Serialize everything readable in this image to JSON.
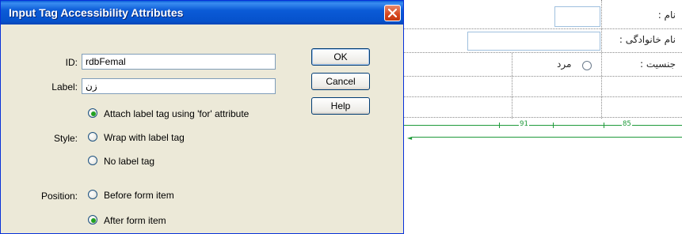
{
  "dialog": {
    "title": "Input Tag Accessibility Attributes",
    "close_icon": "close-icon",
    "fields": {
      "id_label": "ID:",
      "id_value": "rdbFemal",
      "label_label": "Label:",
      "label_value": "زن"
    },
    "style": {
      "label": "Style:",
      "options": [
        {
          "label": "Attach label tag using 'for' attribute",
          "selected": true
        },
        {
          "label": "Wrap with label tag",
          "selected": false
        },
        {
          "label": "No label tag",
          "selected": false
        }
      ]
    },
    "position": {
      "label": "Position:",
      "options": [
        {
          "label": "Before form item",
          "selected": false
        },
        {
          "label": "After form item",
          "selected": true
        }
      ]
    },
    "buttons": {
      "ok": "OK",
      "cancel": "Cancel",
      "help": "Help"
    }
  },
  "design_view": {
    "rows": [
      {
        "label": "نام :"
      },
      {
        "label": "نام خانوادگی :"
      },
      {
        "label": "جنسیت :",
        "radio_label": "مرد"
      }
    ],
    "ruler": {
      "left_value": "91",
      "right_value": "85"
    },
    "colors": {
      "ruler": "#1f9a3a",
      "field_border": "#9fc0de"
    }
  }
}
